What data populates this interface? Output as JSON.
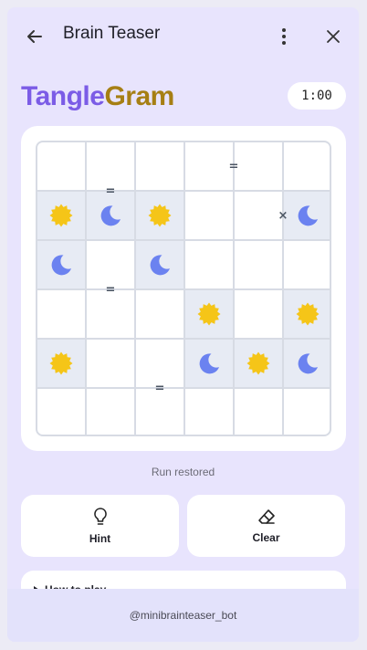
{
  "header": {
    "title": "Brain Teaser"
  },
  "brand": {
    "part1": "Tangle",
    "part2": "Gram"
  },
  "timer": "1:00",
  "board": {
    "size": 6,
    "sun_color": "#f5c518",
    "moon_color": "#6b82f0",
    "cells": [
      [
        "",
        "",
        "",
        "",
        "",
        ""
      ],
      [
        "sun",
        "moon",
        "sun",
        "",
        "",
        "moon"
      ],
      [
        "moon",
        "",
        "moon",
        "",
        "",
        ""
      ],
      [
        "",
        "",
        "",
        "sun",
        "",
        "sun"
      ],
      [
        "sun",
        "",
        "",
        "moon",
        "sun",
        "moon"
      ],
      [
        "",
        "",
        "",
        "",
        "",
        ""
      ]
    ],
    "locked": [
      [
        false,
        false,
        false,
        false,
        false,
        false
      ],
      [
        true,
        true,
        true,
        false,
        false,
        true
      ],
      [
        true,
        false,
        true,
        false,
        false,
        false
      ],
      [
        false,
        false,
        false,
        true,
        false,
        true
      ],
      [
        true,
        false,
        false,
        true,
        true,
        true
      ],
      [
        false,
        false,
        false,
        false,
        false,
        false
      ]
    ],
    "constraints": [
      {
        "row": 0,
        "col": 3,
        "dir": "right",
        "symbol": "="
      },
      {
        "row": 0,
        "col": 1,
        "dir": "down",
        "symbol": "="
      },
      {
        "row": 1,
        "col": 4,
        "dir": "right",
        "symbol": "×"
      },
      {
        "row": 2,
        "col": 1,
        "dir": "down",
        "symbol": "="
      },
      {
        "row": 4,
        "col": 2,
        "dir": "down",
        "symbol": "="
      }
    ]
  },
  "status": "Run restored",
  "actions": {
    "hint": "Hint",
    "clear": "Clear"
  },
  "howto": {
    "label": "How to play"
  },
  "footer": {
    "handle": "@minibrainteaser_bot"
  }
}
